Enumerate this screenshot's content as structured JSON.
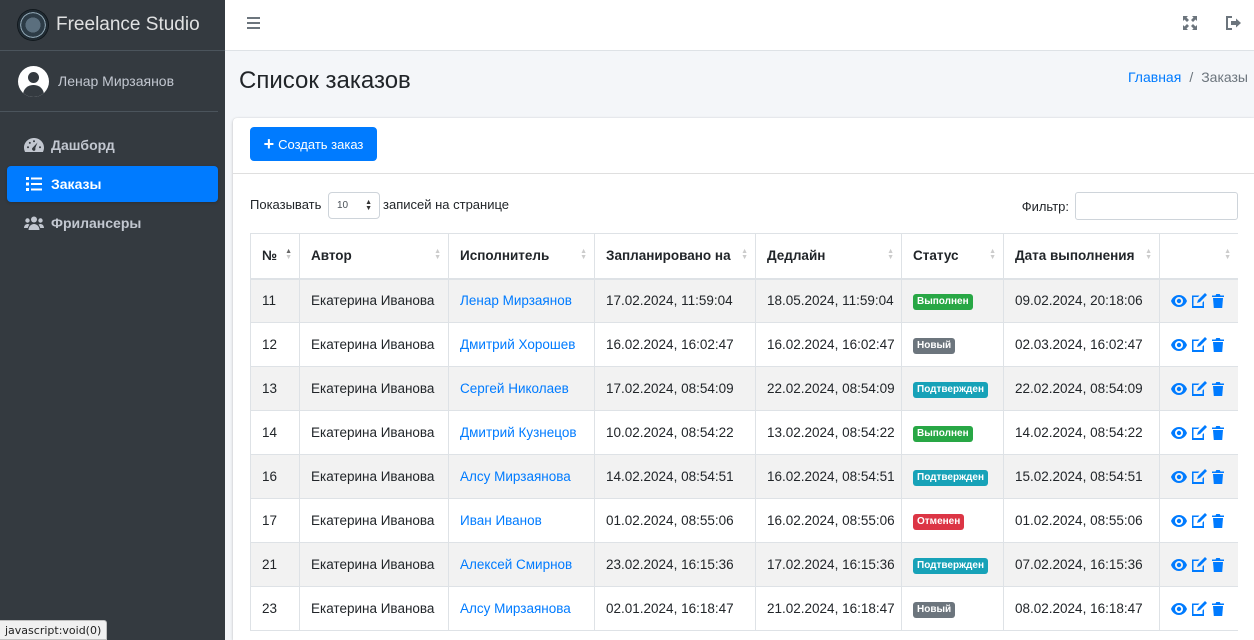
{
  "brand": {
    "title": "Freelance Studio"
  },
  "user": {
    "name": "Ленар Мирзаянов"
  },
  "sidebar": {
    "items": [
      {
        "label": "Дашборд",
        "icon": "tachometer-icon",
        "active": false
      },
      {
        "label": "Заказы",
        "icon": "list-icon",
        "active": true
      },
      {
        "label": "Фрилансеры",
        "icon": "users-icon",
        "active": false
      }
    ]
  },
  "header": {
    "title": "Список заказов",
    "breadcrumb": {
      "home": "Главная",
      "current": "Заказы"
    }
  },
  "toolbar": {
    "create_label": "Создать заказ"
  },
  "table_controls": {
    "length_prefix": "Показывать",
    "length_value": "10",
    "length_suffix": "записей на странице",
    "filter_label": "Фильтр:"
  },
  "table": {
    "headers": [
      "№",
      "Автор",
      "Исполнитель",
      "Запланировано на",
      "Дедлайн",
      "Статус",
      "Дата выполнения",
      ""
    ],
    "rows": [
      {
        "id": "11",
        "author": "Екатерина Иванова",
        "executor": "Ленар Мирзаянов",
        "planned": "17.02.2024, 11:59:04",
        "deadline": "18.05.2024, 11:59:04",
        "status": "Выполнен",
        "status_type": "success",
        "completed": "09.02.2024, 20:18:06"
      },
      {
        "id": "12",
        "author": "Екатерина Иванова",
        "executor": "Дмитрий Хорошев",
        "planned": "16.02.2024, 16:02:47",
        "deadline": "16.02.2024, 16:02:47",
        "status": "Новый",
        "status_type": "secondary",
        "completed": "02.03.2024, 16:02:47"
      },
      {
        "id": "13",
        "author": "Екатерина Иванова",
        "executor": "Сергей Николаев",
        "planned": "17.02.2024, 08:54:09",
        "deadline": "22.02.2024, 08:54:09",
        "status": "Подтвержден",
        "status_type": "info",
        "completed": "22.02.2024, 08:54:09"
      },
      {
        "id": "14",
        "author": "Екатерина Иванова",
        "executor": "Дмитрий Кузнецов",
        "planned": "10.02.2024, 08:54:22",
        "deadline": "13.02.2024, 08:54:22",
        "status": "Выполнен",
        "status_type": "success",
        "completed": "14.02.2024, 08:54:22"
      },
      {
        "id": "16",
        "author": "Екатерина Иванова",
        "executor": "Алсу Мирзаянова",
        "planned": "14.02.2024, 08:54:51",
        "deadline": "16.02.2024, 08:54:51",
        "status": "Подтвержден",
        "status_type": "info",
        "completed": "15.02.2024, 08:54:51"
      },
      {
        "id": "17",
        "author": "Екатерина Иванова",
        "executor": "Иван Иванов",
        "planned": "01.02.2024, 08:55:06",
        "deadline": "16.02.2024, 08:55:06",
        "status": "Отменен",
        "status_type": "danger",
        "completed": "01.02.2024, 08:55:06"
      },
      {
        "id": "21",
        "author": "Екатерина Иванова",
        "executor": "Алексей Смирнов",
        "planned": "23.02.2024, 16:15:36",
        "deadline": "17.02.2024, 16:15:36",
        "status": "Подтвержден",
        "status_type": "info",
        "completed": "07.02.2024, 16:15:36"
      },
      {
        "id": "23",
        "author": "Екатерина Иванова",
        "executor": "Алсу Мирзаянова",
        "planned": "02.01.2024, 16:18:47",
        "deadline": "21.02.2024, 16:18:47",
        "status": "Новый",
        "status_type": "secondary",
        "completed": "08.02.2024, 16:18:47"
      }
    ]
  },
  "status_bar": {
    "text": "javascript:void(0)"
  },
  "colors": {
    "accent": "#007bff",
    "sidebar_bg": "#343a40",
    "success": "#28a745",
    "info": "#17a2b8",
    "danger": "#dc3545",
    "secondary": "#6c757d"
  }
}
